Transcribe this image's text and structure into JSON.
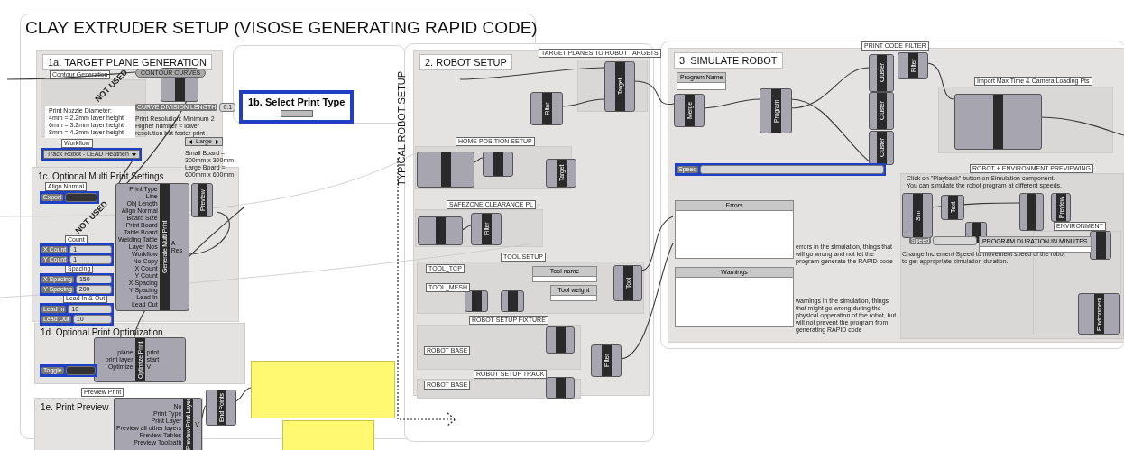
{
  "title": "CLAY EXTRUDER SETUP (VISOSE GENERATING RAPID CODE)",
  "side_label": "TYPICAL ROBOT SETUP",
  "groups": [
    {
      "heading": "1a. TARGET PLANE GENERATION",
      "kind": "boxed"
    },
    {
      "heading": "1c. Optional Multi Print Settings",
      "kind": "plain"
    },
    {
      "heading": "1d. Optional Print Optimization",
      "kind": "plain"
    },
    {
      "heading": "1e. Print Preview",
      "kind": "plain"
    },
    {
      "heading": "2. ROBOT SETUP",
      "kind": "boxed"
    },
    {
      "heading": "3. SIMULATE ROBOT",
      "kind": "boxed"
    }
  ],
  "print_type": {
    "heading": "1b. Select Print Type"
  },
  "subgroups": [
    {
      "label": "Contour Generation"
    },
    {
      "label": "HOME POSITION SETUP"
    },
    {
      "label": "SAFEZONE CLEARANCE PL"
    },
    {
      "label": "TOOL SETUP"
    },
    {
      "label": "ROBOT SETUP FIXTURE"
    },
    {
      "label": "ROBOT SETUP TRACK"
    },
    {
      "label": "TARGET PLANES TO ROBOT TARGETS"
    },
    {
      "label": "Import Max Time & Camera Loading Pts"
    },
    {
      "label": "ROBOT + ENVIRONMENT PREVIEWING"
    },
    {
      "label": "ENVIRONMENT"
    }
  ],
  "stamps": [
    {
      "text": "NOT USED"
    },
    {
      "text": "NOT USED"
    }
  ],
  "notes": [
    {
      "text": "Print Nozzle Diameter:\n4mm = 2.2mm layer height\n6mm = 3.2mm layer height\n8mm = 4.2mm layer height"
    },
    {
      "text": "Print Resolution: Minimum 2\nHigher number = lower resolution but faster print"
    },
    {
      "text": "Small Board = 300mm x 300mm\nLarge Board = 600mm x 600mm"
    },
    {
      "text": "errors in the simulation, things that will go wrong and not let the program generate the RAPID code"
    },
    {
      "text": "warnings in the simulation, things that might go wrong during the physical opperation of the robot, but will not prevent the program from generating RAPID code"
    },
    {
      "text": "Click on \"Playback\" button on Simulation component.\nYou can simulate the robot program at different speeds."
    },
    {
      "text": "Change Increment Speed to movement speed of the robot\nto get appropriate simulation duration."
    }
  ],
  "tags": [
    {
      "label": "Workflow"
    },
    {
      "label": "Align Normal"
    },
    {
      "label": "Count"
    },
    {
      "label": "Spacing"
    },
    {
      "label": "Lead In & Out"
    },
    {
      "label": "Preview Print"
    },
    {
      "label": "TOOL_TCP"
    },
    {
      "label": "TOOL_MESH"
    },
    {
      "label": "ROBOT BASE"
    },
    {
      "label": "ROBOT BASE"
    },
    {
      "label": "PRINT CODE FILTER"
    }
  ],
  "params": [
    {
      "kind": "capsule",
      "label": "CONTOUR CURVES",
      "highlighted": false
    },
    {
      "kind": "slider",
      "label": "CURVE DIVISION LENGTH",
      "value": "0.1",
      "highlighted": false
    },
    {
      "kind": "stepper",
      "label": "Large",
      "highlighted": false
    },
    {
      "kind": "dropdown",
      "label": "Track Robot - LEAD Heathen",
      "highlighted": true
    },
    {
      "kind": "toggle",
      "label": "Export",
      "highlighted": true
    },
    {
      "kind": "slider",
      "label": "X Count",
      "value": "1",
      "highlighted": true
    },
    {
      "kind": "slider",
      "label": "Y Count",
      "value": "1",
      "highlighted": true
    },
    {
      "kind": "slider",
      "label": "X Spacing",
      "value": "150",
      "highlighted": true
    },
    {
      "kind": "slider",
      "label": "Y Spacing",
      "value": "200",
      "highlighted": true
    },
    {
      "kind": "slider",
      "label": "Lead In",
      "value": "10",
      "highlighted": true
    },
    {
      "kind": "slider",
      "label": "Lead Out",
      "value": "10",
      "highlighted": true
    },
    {
      "kind": "toggle",
      "label": "Toggle",
      "highlighted": true
    },
    {
      "kind": "slider",
      "label": "Speed",
      "highlighted": true
    },
    {
      "kind": "slider",
      "label": "Speed",
      "highlighted": false
    }
  ],
  "panels": [
    {
      "title": "Program Name"
    },
    {
      "title": "Tool name"
    },
    {
      "title": "Tool weight"
    },
    {
      "title": "Errors"
    },
    {
      "title": "Warnings"
    },
    {
      "title": "PROGRAM DURATION IN MINUTES"
    }
  ],
  "nodes": [
    {
      "name": "Generate Multi Print",
      "inputs": [
        "Print Type",
        "Line",
        "Obj Length",
        "Align Normal",
        "Board Size",
        "Print Board",
        "Table Board",
        "Welding Table",
        "Layer Nos",
        "Workflow",
        "No Copy",
        "X Count",
        "Y Count",
        "X Spacing",
        "Y Spacing",
        "Lead In",
        "Lead Out"
      ],
      "outputs": [
        "A",
        "Res"
      ]
    },
    {
      "name": "Preview"
    },
    {
      "name": "Optimize Print",
      "inputs": [
        "plane",
        "print layer",
        "Optimize"
      ],
      "outputs": [
        "print",
        "start",
        "V"
      ]
    },
    {
      "name": "Preview Print Layer",
      "inputs": [
        "No",
        "Print Type",
        "Print Layer",
        "Preview all other layers",
        "Preview Tables",
        "Preview Toolpath"
      ],
      "outputs": [
        "V"
      ]
    },
    {
      "name": "End Points"
    },
    {
      "name": "Target"
    },
    {
      "name": "Filter"
    },
    {
      "name": "Target"
    },
    {
      "name": "Filter"
    },
    {
      "name": "Tool"
    },
    {
      "name": "Filter"
    },
    {
      "name": "Merge"
    },
    {
      "name": "Program"
    },
    {
      "name": "Cluster"
    },
    {
      "name": "Filter"
    },
    {
      "name": "Cluster"
    },
    {
      "name": "Cluster"
    },
    {
      "name": "Sim"
    },
    {
      "name": "Text"
    },
    {
      "name": "Preview"
    },
    {
      "name": "Environment"
    }
  ]
}
